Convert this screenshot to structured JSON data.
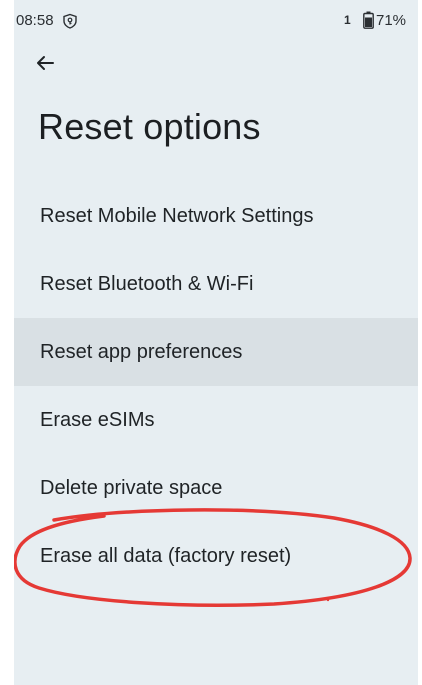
{
  "status_bar": {
    "time": "08:58",
    "vpn_icon": "vpn-key-icon",
    "sim_count": "1",
    "battery_icon": "battery-icon",
    "battery_percent": "71%"
  },
  "header": {
    "back_icon": "arrow-back-icon",
    "title": "Reset options"
  },
  "options": [
    {
      "label": "Reset Mobile Network Settings",
      "highlighted": false
    },
    {
      "label": "Reset Bluetooth & Wi-Fi",
      "highlighted": false
    },
    {
      "label": "Reset app preferences",
      "highlighted": true
    },
    {
      "label": "Erase eSIMs",
      "highlighted": false
    },
    {
      "label": "Delete private space",
      "highlighted": false
    },
    {
      "label": "Erase all data (factory reset)",
      "highlighted": false
    }
  ],
  "annotation": {
    "type": "ellipse",
    "color": "#e53935",
    "target": "Erase all data (factory reset)"
  },
  "colors": {
    "background": "#e7eef2",
    "highlight": "#d9e0e4",
    "text": "#1f2326"
  }
}
